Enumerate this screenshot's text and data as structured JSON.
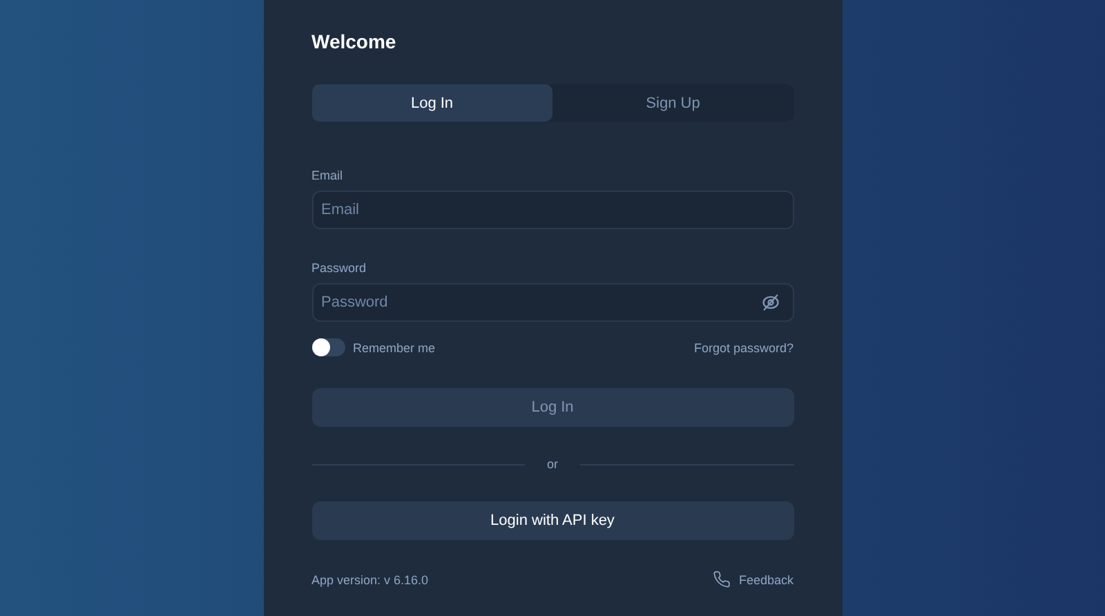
{
  "title": "Welcome",
  "tabs": [
    {
      "label": "Log In",
      "selected": true
    },
    {
      "label": "Sign Up",
      "selected": false
    }
  ],
  "fields": [
    {
      "label": "Email",
      "placeholder": "Email",
      "kind": "text"
    },
    {
      "label": "Password",
      "placeholder": "Password",
      "kind": "password"
    }
  ],
  "remember": {
    "label": "Remember me",
    "on": false
  },
  "forgot_link": "Forgot password?",
  "login_button": {
    "label": "Log In",
    "disabled": true
  },
  "divider_text": "or",
  "api_button": "Login with API key",
  "version": "App version: v 6.16.0",
  "feedback_link": "Feedback"
}
